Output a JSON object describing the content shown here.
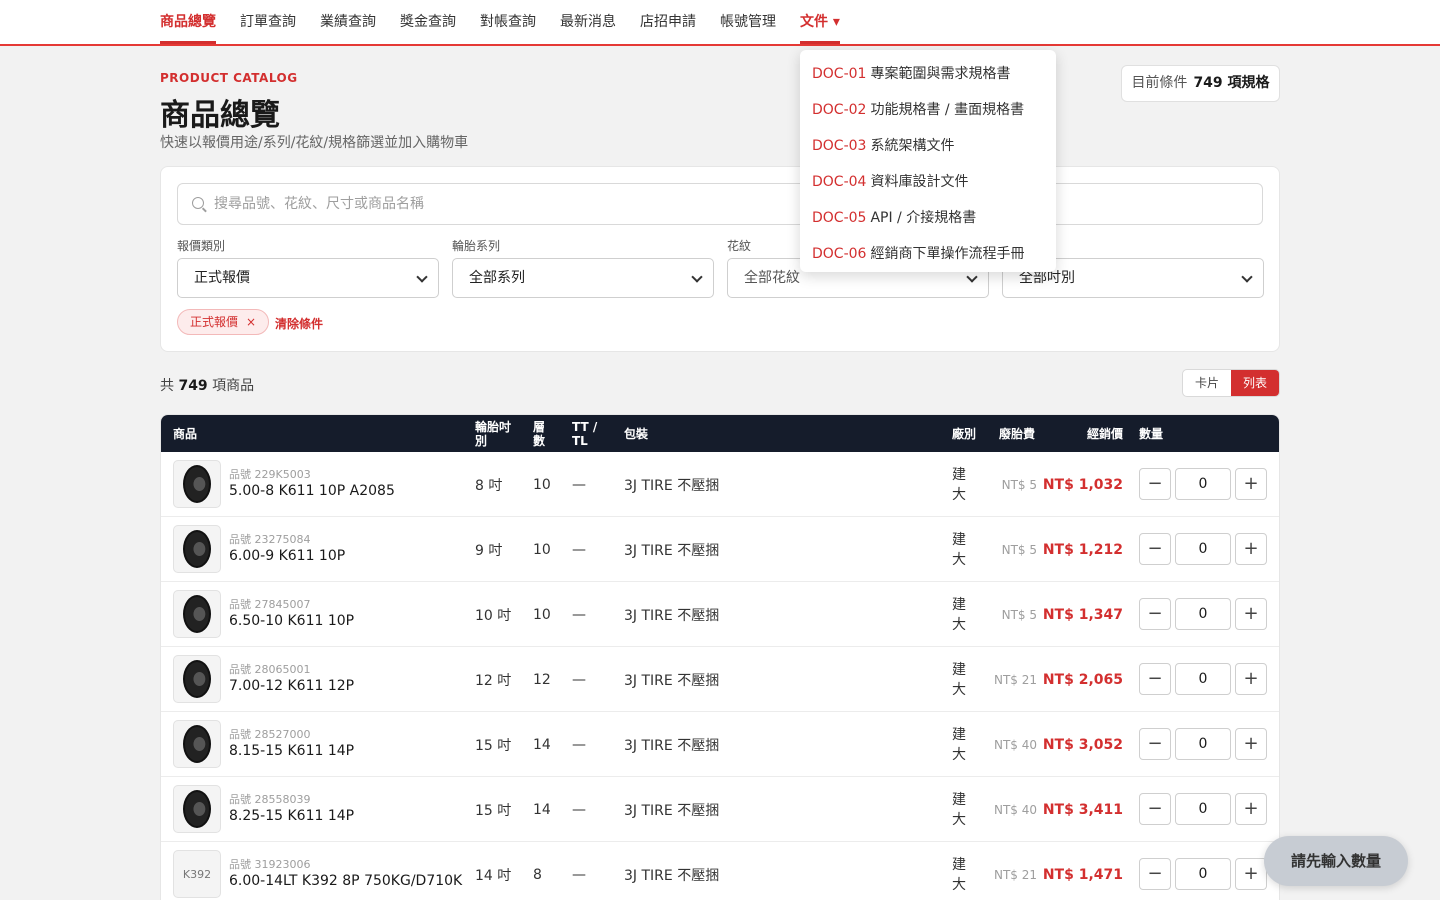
{
  "nav": {
    "items": [
      "商品總覽",
      "訂單查詢",
      "業績查詢",
      "獎金查詢",
      "對帳查詢",
      "最新消息",
      "店招申請",
      "帳號管理"
    ],
    "docs_label": "文件 ▾"
  },
  "header": {
    "kicker": "PRODUCT CATALOG",
    "title": "商品總覽",
    "subtitle": "快速以報價用途/系列/花紋/規格篩選並加入購物車",
    "condition_label": "目前條件",
    "condition_count": "749 項規格"
  },
  "filters": {
    "search_placeholder": "搜尋品號、花紋、尺寸或商品名稱",
    "quote_type_label": "報價類別",
    "quote_type_value": "正式報價",
    "series_label": "輪胎系列",
    "series_value": "全部系列",
    "pattern_label": "花紋",
    "pattern_value": "全部花紋",
    "size_value": "全部吋別",
    "active_chip": "正式報價",
    "chip_close": "×",
    "clear_label": "清除條件"
  },
  "results": {
    "prefix": "共",
    "count": "749",
    "suffix": "項商品",
    "view_card": "卡片",
    "view_list": "列表"
  },
  "table": {
    "headers": {
      "product": "商品",
      "size": "輪胎吋\n別",
      "ply": "層\n數",
      "tt": "TT /\nTL",
      "pack": "包裝",
      "factory": "廠別",
      "fee": "廢胎費",
      "price": "經銷價",
      "qty": "數量"
    },
    "rows": [
      {
        "thumb": "",
        "sku": "品號 229K5003",
        "name": "5.00-8 K611 10P A2085",
        "size": "8 吋",
        "ply": "10",
        "tt": "—",
        "pack": "3J TIRE 不壓捆",
        "factory1": "建",
        "factory2": "大",
        "fee": "NT$ 5",
        "price": "NT$ 1,032",
        "qty": "0"
      },
      {
        "thumb": "",
        "sku": "品號 23275084",
        "name": "6.00-9 K611 10P",
        "size": "9 吋",
        "ply": "10",
        "tt": "—",
        "pack": "3J TIRE 不壓捆",
        "factory1": "建",
        "factory2": "大",
        "fee": "NT$ 5",
        "price": "NT$ 1,212",
        "qty": "0"
      },
      {
        "thumb": "",
        "sku": "品號 27845007",
        "name": "6.50-10 K611 10P",
        "size": "10 吋",
        "ply": "10",
        "tt": "—",
        "pack": "3J TIRE 不壓捆",
        "factory1": "建",
        "factory2": "大",
        "fee": "NT$ 5",
        "price": "NT$ 1,347",
        "qty": "0"
      },
      {
        "thumb": "",
        "sku": "品號 28065001",
        "name": "7.00-12 K611 12P",
        "size": "12 吋",
        "ply": "12",
        "tt": "—",
        "pack": "3J TIRE 不壓捆",
        "factory1": "建",
        "factory2": "大",
        "fee": "NT$ 21",
        "price": "NT$ 2,065",
        "qty": "0"
      },
      {
        "thumb": "",
        "sku": "品號 28527000",
        "name": "8.15-15 K611 14P",
        "size": "15 吋",
        "ply": "14",
        "tt": "—",
        "pack": "3J TIRE 不壓捆",
        "factory1": "建",
        "factory2": "大",
        "fee": "NT$ 40",
        "price": "NT$ 3,052",
        "qty": "0"
      },
      {
        "thumb": "",
        "sku": "品號 28558039",
        "name": "8.25-15 K611 14P",
        "size": "15 吋",
        "ply": "14",
        "tt": "—",
        "pack": "3J TIRE 不壓捆",
        "factory1": "建",
        "factory2": "大",
        "fee": "NT$ 40",
        "price": "NT$ 3,411",
        "qty": "0"
      },
      {
        "thumb": "K392",
        "sku": "品號 31923006",
        "name": "6.00-14LT K392 8P 750KG/D710K",
        "size": "14 吋",
        "ply": "8",
        "tt": "—",
        "pack": "3J TIRE 不壓捆",
        "factory1": "建",
        "factory2": "大",
        "fee": "NT$ 21",
        "price": "NT$ 1,471",
        "qty": "0"
      }
    ],
    "minus": "−",
    "plus": "+"
  },
  "docs_menu": [
    {
      "code": "DOC-01",
      "title": "專案範圍與需求規格書"
    },
    {
      "code": "DOC-02",
      "title": "功能規格書 / 畫面規格書"
    },
    {
      "code": "DOC-03",
      "title": "系統架構文件"
    },
    {
      "code": "DOC-04",
      "title": "資料庫設計文件"
    },
    {
      "code": "DOC-05",
      "title": "API / 介接規格書"
    },
    {
      "code": "DOC-06",
      "title": "經銷商下單操作流程手冊"
    }
  ],
  "floating_button": "請先輸入數量",
  "colors": {
    "accent": "#d32f2f",
    "header_bg": "#151c2b",
    "page_bg": "#f2f2f2"
  }
}
